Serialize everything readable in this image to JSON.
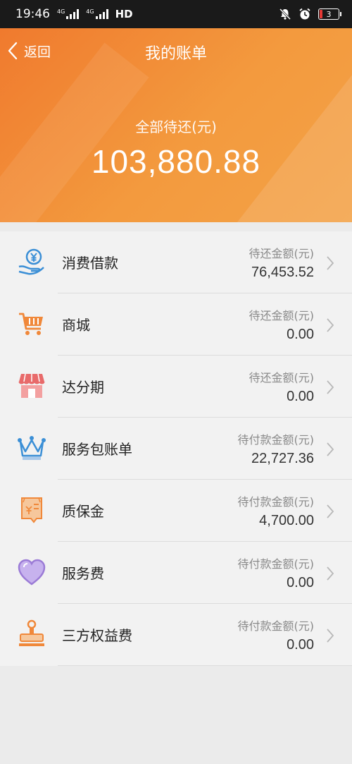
{
  "status_bar": {
    "time": "19:46",
    "network1": "4G",
    "network2": "4G",
    "hd": "HD",
    "battery": "3"
  },
  "header": {
    "back_label": "返回",
    "title": "我的账单",
    "summary_label": "全部待还(元)",
    "summary_amount": "103,880.88"
  },
  "colors": {
    "header_start": "#f07a2e",
    "header_end": "#f3a247",
    "icon_orange": "#f0883a",
    "icon_blue": "#3b8fd6",
    "icon_red": "#e86a6a",
    "icon_purple": "#9b7bd6"
  },
  "items": [
    {
      "name": "消费借款",
      "label": "待还金额(元)",
      "amount": "76,453.52",
      "icon": "yen-hand-icon"
    },
    {
      "name": "商城",
      "label": "待还金额(元)",
      "amount": "0.00",
      "icon": "shopping-cart-icon"
    },
    {
      "name": "达分期",
      "label": "待还金额(元)",
      "amount": "0.00",
      "icon": "storefront-icon"
    },
    {
      "name": "服务包账单",
      "label": "待付款金额(元)",
      "amount": "22,727.36",
      "icon": "crown-icon"
    },
    {
      "name": "质保金",
      "label": "待付款金额(元)",
      "amount": "4,700.00",
      "icon": "certificate-icon"
    },
    {
      "name": "服务费",
      "label": "待付款金额(元)",
      "amount": "0.00",
      "icon": "heart-icon"
    },
    {
      "name": "三方权益费",
      "label": "待付款金额(元)",
      "amount": "0.00",
      "icon": "stamp-icon"
    }
  ]
}
